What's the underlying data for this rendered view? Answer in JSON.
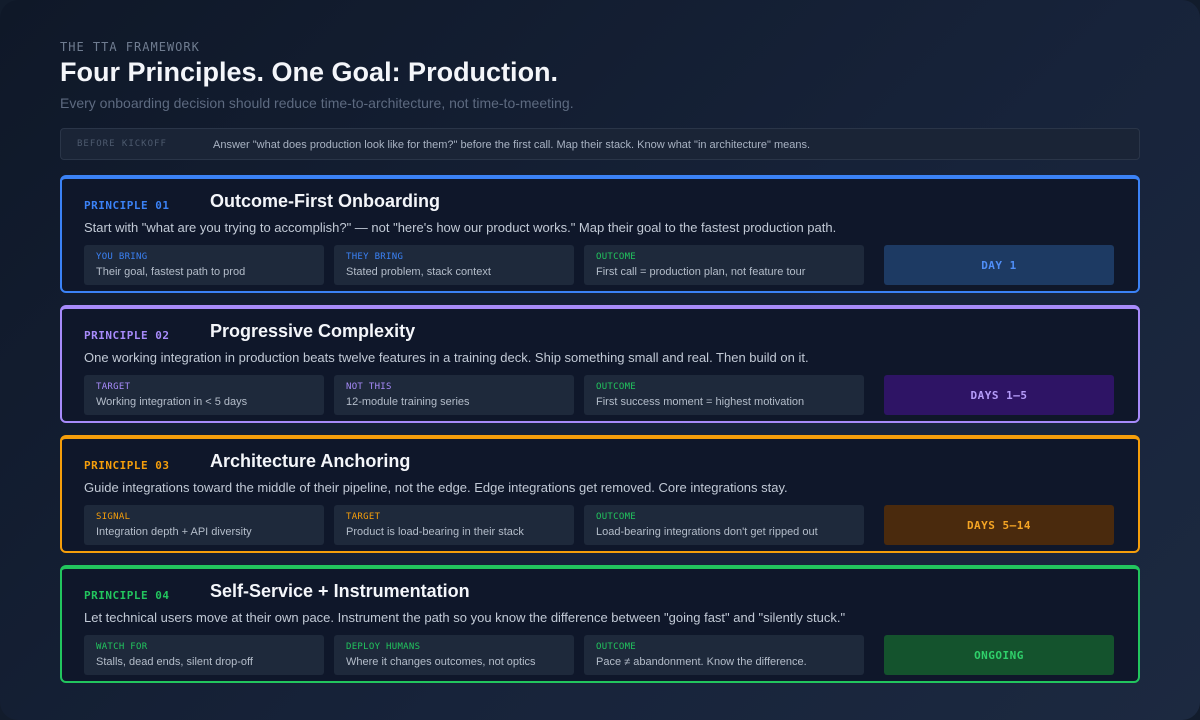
{
  "header": {
    "eyebrow": "THE TTA FRAMEWORK",
    "title": "Four Principles. One Goal: Production.",
    "subtitle": "Every onboarding decision should reduce time-to-architecture, not time-to-meeting."
  },
  "kickoff": {
    "tag": "BEFORE KICKOFF",
    "text": "Answer \"what does production look like for them?\" before the first call. Map their stack. Know what \"in architecture\" means."
  },
  "principles": [
    {
      "label": "PRINCIPLE 01",
      "title": "Outcome-First Onboarding",
      "description": "Start with \"what are you trying to accomplish?\" — not \"here's how our product works.\" Map their goal to the fastest production path.",
      "accent": "#3b82f6",
      "cells": [
        {
          "key": "YOU BRING",
          "value": "Their goal, fastest path to prod",
          "key_color": "#3b82f6"
        },
        {
          "key": "THEY BRING",
          "value": "Stated problem, stack context",
          "key_color": "#3b82f6"
        },
        {
          "key": "OUTCOME",
          "value": "First call = production plan, not feature tour",
          "key_color": "#22c55e"
        }
      ],
      "badge": {
        "label": "DAY 1",
        "bg": "#1d3a63",
        "color": "#4f8ef7"
      }
    },
    {
      "label": "PRINCIPLE 02",
      "title": "Progressive Complexity",
      "description": "One working integration in production beats twelve features in a training deck. Ship something small and real. Then build on it.",
      "accent": "#a78bfa",
      "cells": [
        {
          "key": "TARGET",
          "value": "Working integration in < 5 days",
          "key_color": "#a78bfa"
        },
        {
          "key": "NOT THIS",
          "value": "12-module training series",
          "key_color": "#a78bfa"
        },
        {
          "key": "OUTCOME",
          "value": "First success moment = highest motivation",
          "key_color": "#22c55e"
        }
      ],
      "badge": {
        "label": "DAYS 1–5",
        "bg": "#2e1465",
        "color": "#b59cfa"
      }
    },
    {
      "label": "PRINCIPLE 03",
      "title": "Architecture Anchoring",
      "description": "Guide integrations toward the middle of their pipeline, not the edge. Edge integrations get removed. Core integrations stay.",
      "accent": "#f59e0b",
      "cells": [
        {
          "key": "SIGNAL",
          "value": "Integration depth + API diversity",
          "key_color": "#f59e0b"
        },
        {
          "key": "TARGET",
          "value": "Product is load-bearing in their stack",
          "key_color": "#f59e0b"
        },
        {
          "key": "OUTCOME",
          "value": "Load-bearing integrations don't get ripped out",
          "key_color": "#22c55e"
        }
      ],
      "badge": {
        "label": "DAYS 5–14",
        "bg": "#4a2a0d",
        "color": "#f5a524"
      }
    },
    {
      "label": "PRINCIPLE 04",
      "title": "Self-Service + Instrumentation",
      "description": "Let technical users move at their own pace. Instrument the path so you know the difference between \"going fast\" and \"silently stuck.\"",
      "accent": "#22c55e",
      "cells": [
        {
          "key": "WATCH FOR",
          "value": "Stalls, dead ends, silent drop-off",
          "key_color": "#22c55e"
        },
        {
          "key": "DEPLOY HUMANS",
          "value": "Where it changes outcomes, not optics",
          "key_color": "#22c55e"
        },
        {
          "key": "OUTCOME",
          "value": "Pace ≠ abandonment. Know the difference.",
          "key_color": "#22c55e"
        }
      ],
      "badge": {
        "label": "ONGOING",
        "bg": "#14532d",
        "color": "#2fd06a"
      }
    }
  ]
}
